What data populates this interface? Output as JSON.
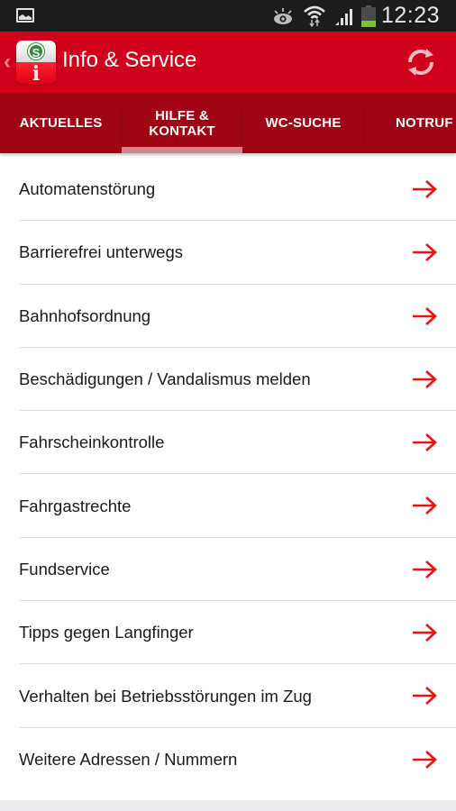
{
  "status_bar": {
    "time": "12:23",
    "icons": [
      "gallery-notification-icon",
      "eye-icon",
      "wifi-icon",
      "signal-icon",
      "battery-icon"
    ],
    "battery_color": "#7cc22a"
  },
  "action_bar": {
    "title": "Info & Service",
    "back_glyph": "‹",
    "logo": {
      "badge": "S",
      "glyph": "i"
    },
    "brand_color": "#d0021b"
  },
  "tabs": [
    {
      "label": "AKTUELLES",
      "active": false
    },
    {
      "label": "HILFE &\nKONTAKT",
      "active": true
    },
    {
      "label": "WC-SUCHE",
      "active": false
    },
    {
      "label": "NOTRUF",
      "active": false
    }
  ],
  "list": {
    "items": [
      {
        "label": "Automatenstörung"
      },
      {
        "label": "Barrierefrei unterwegs"
      },
      {
        "label": "Bahnhofsordnung"
      },
      {
        "label": "Beschädigungen / Vandalismus melden"
      },
      {
        "label": "Fahrscheinkontrolle"
      },
      {
        "label": "Fahrgastrechte"
      },
      {
        "label": "Fundservice"
      },
      {
        "label": "Tipps gegen Langfinger"
      },
      {
        "label": "Verhalten bei Betriebsstörungen im Zug"
      },
      {
        "label": "Weitere Adressen / Nummern"
      }
    ],
    "arrow_color": "#f01010"
  }
}
